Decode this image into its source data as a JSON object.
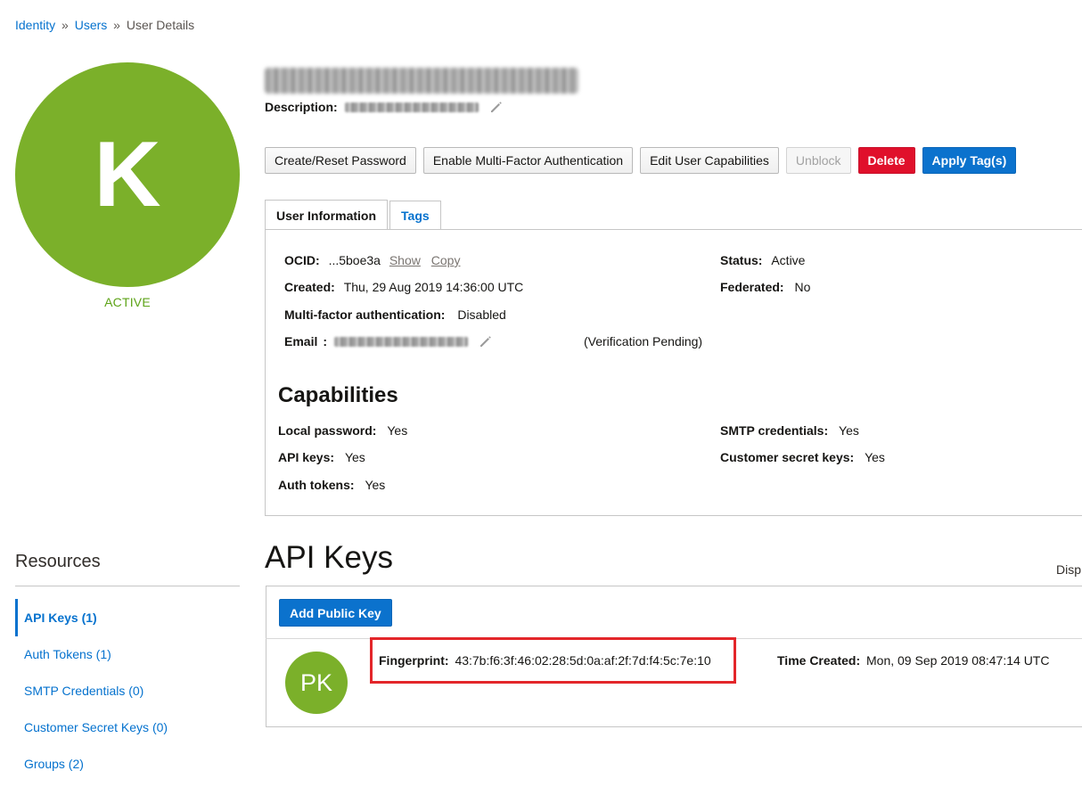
{
  "breadcrumb": {
    "identity": "Identity",
    "sep1": "»",
    "users": "Users",
    "sep2": "»",
    "current": "User Details"
  },
  "avatar": {
    "letter": "K",
    "status": "ACTIVE",
    "color": "#7bb02a"
  },
  "header": {
    "description_label": "Description:"
  },
  "actions": {
    "create_reset_password": "Create/Reset Password",
    "enable_mfa": "Enable Multi-Factor Authentication",
    "edit_capabilities": "Edit User Capabilities",
    "unblock": "Unblock",
    "delete": "Delete",
    "apply_tags": "Apply Tag(s)"
  },
  "tabs": {
    "user_information": "User Information",
    "tags": "Tags"
  },
  "user_info": {
    "ocid_label": "OCID:",
    "ocid_value": "...5boe3a",
    "show": "Show",
    "copy": "Copy",
    "created_label": "Created:",
    "created_value": "Thu, 29 Aug 2019 14:36:00 UTC",
    "mfa_label": "Multi-factor authentication:",
    "mfa_value": "Disabled",
    "email_label": "Email",
    "email_colon": ":",
    "email_status": "(Verification Pending)",
    "status_label": "Status:",
    "status_value": "Active",
    "federated_label": "Federated:",
    "federated_value": "No"
  },
  "capabilities": {
    "title": "Capabilities",
    "local_password_label": "Local password:",
    "local_password_value": "Yes",
    "api_keys_label": "API keys:",
    "api_keys_value": "Yes",
    "auth_tokens_label": "Auth tokens:",
    "auth_tokens_value": "Yes",
    "smtp_label": "SMTP credentials:",
    "smtp_value": "Yes",
    "customer_secret_label": "Customer secret keys:",
    "customer_secret_value": "Yes"
  },
  "resources": {
    "title": "Resources",
    "items": [
      {
        "label": "API Keys (1)"
      },
      {
        "label": "Auth Tokens (1)"
      },
      {
        "label": "SMTP Credentials (0)"
      },
      {
        "label": "Customer Secret Keys (0)"
      },
      {
        "label": "Groups (2)"
      }
    ]
  },
  "api_keys": {
    "title": "API Keys",
    "display_trunc": "Disp",
    "add_button": "Add Public Key",
    "key": {
      "avatar": "PK",
      "fingerprint_label": "Fingerprint:",
      "fingerprint_value": "43:7b:f6:3f:46:02:28:5d:0a:af:2f:7d:f4:5c:7e:10",
      "time_created_label": "Time Created:",
      "time_created_value": "Mon, 09 Sep 2019 08:47:14 UTC"
    }
  },
  "colors": {
    "link": "#0572ce",
    "danger": "#e0102b",
    "primary": "#0b72cd",
    "highlight": "#e3262a"
  }
}
